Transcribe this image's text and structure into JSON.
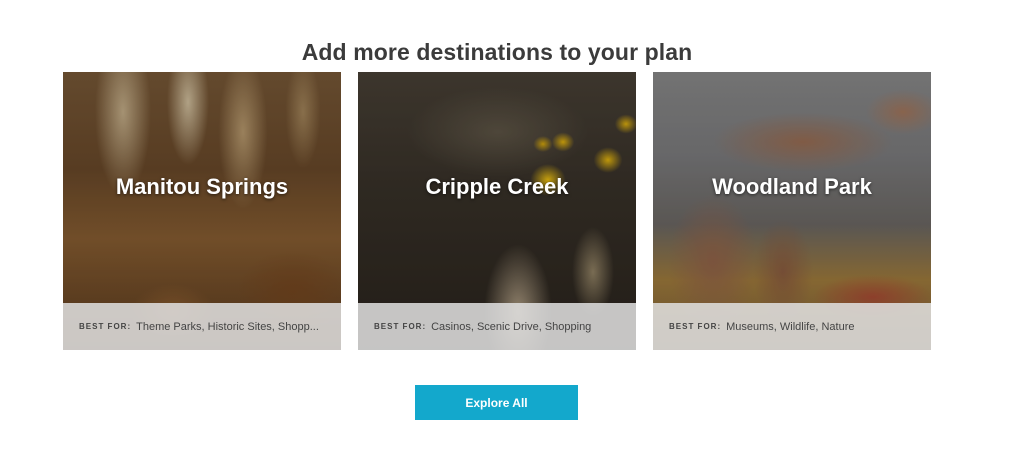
{
  "section": {
    "title": "Add more destinations to your plan"
  },
  "cards": [
    {
      "title": "Manitou Springs",
      "best_for_label": "BEST FOR:",
      "best_for_value": "Theme Parks, Historic Sites, Shopp..."
    },
    {
      "title": "Cripple Creek",
      "best_for_label": "BEST FOR:",
      "best_for_value": "Casinos, Scenic Drive, Shopping"
    },
    {
      "title": "Woodland Park",
      "best_for_label": "BEST FOR:",
      "best_for_value": "Museums, Wildlife, Nature"
    }
  ],
  "explore_button": {
    "label": "Explore All"
  },
  "colors": {
    "accent": "#13a8cc",
    "title_text": "#3b3b3b",
    "footer_text": "#444444"
  }
}
